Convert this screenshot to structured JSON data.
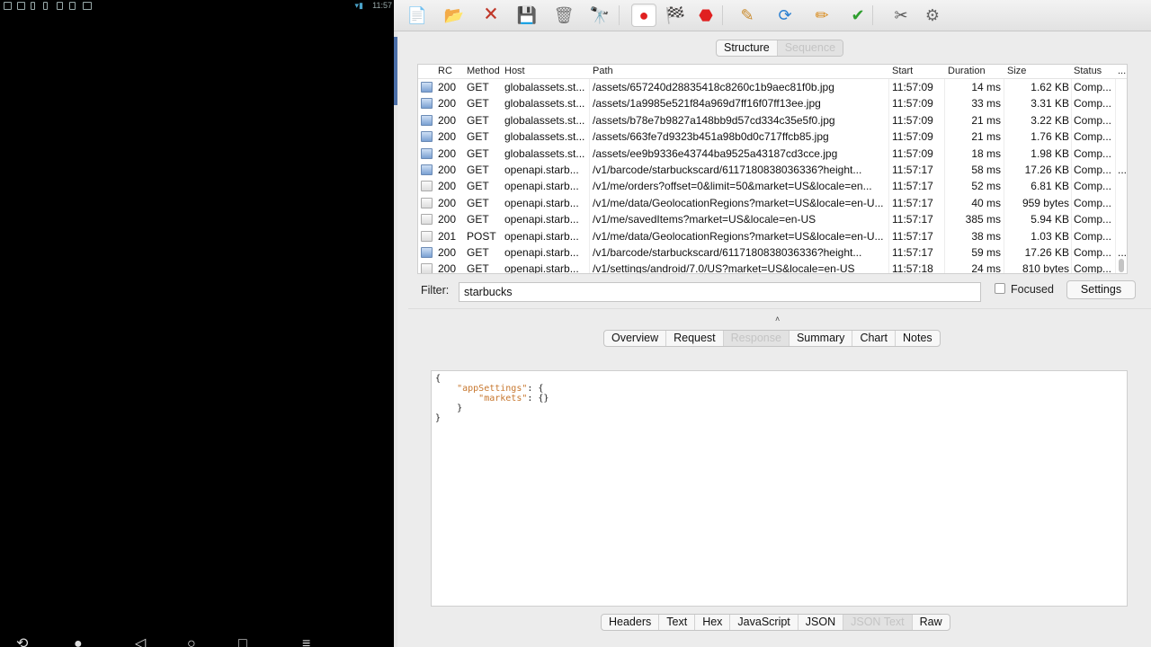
{
  "phone": {
    "status_time": "11:57"
  },
  "toolbar": {
    "buttons": [
      {
        "name": "new-session-icon",
        "glyph": "📄"
      },
      {
        "name": "open-session-icon",
        "glyph": "📂"
      },
      {
        "name": "close-session-icon",
        "glyph": "🗙"
      },
      {
        "name": "save-session-icon",
        "glyph": "💾"
      },
      {
        "name": "clear-session-icon",
        "glyph": "🗑"
      },
      {
        "name": "find-icon",
        "glyph": "🔭"
      },
      {
        "name": "record-icon",
        "glyph": "●"
      },
      {
        "name": "throttle-icon",
        "glyph": "🏁"
      },
      {
        "name": "breakpoints-icon",
        "glyph": "⬣"
      },
      {
        "name": "edit-icon",
        "glyph": "✎"
      },
      {
        "name": "repeat-icon",
        "glyph": "⟳"
      },
      {
        "name": "validate-icon",
        "glyph": "✏"
      },
      {
        "name": "check-icon",
        "glyph": "✔"
      },
      {
        "name": "tools-icon",
        "glyph": "✂"
      },
      {
        "name": "settings-gear-icon",
        "glyph": "⚙"
      }
    ]
  },
  "view_tabs": [
    "Structure",
    "Sequence"
  ],
  "table": {
    "headers": {
      "rc": "RC",
      "method": "Method",
      "host": "Host",
      "path": "Path",
      "start": "Start",
      "duration": "Duration",
      "size": "Size",
      "status": "Status",
      "more": "..."
    },
    "rows": [
      {
        "icon": "image",
        "rc": "200",
        "method": "GET",
        "host": "globalassets.st...",
        "path": "/assets/657240d28835418c8260c1b9aec81f0b.jpg",
        "start": "11:57:09",
        "duration": "14 ms",
        "size": "1.62 KB",
        "status": "Comp...",
        "more": ""
      },
      {
        "icon": "image",
        "rc": "200",
        "method": "GET",
        "host": "globalassets.st...",
        "path": "/assets/1a9985e521f84a969d7ff16f07ff13ee.jpg",
        "start": "11:57:09",
        "duration": "33 ms",
        "size": "3.31 KB",
        "status": "Comp...",
        "more": ""
      },
      {
        "icon": "image",
        "rc": "200",
        "method": "GET",
        "host": "globalassets.st...",
        "path": "/assets/b78e7b9827a148bb9d57cd334c35e5f0.jpg",
        "start": "11:57:09",
        "duration": "21 ms",
        "size": "3.22 KB",
        "status": "Comp...",
        "more": ""
      },
      {
        "icon": "image",
        "rc": "200",
        "method": "GET",
        "host": "globalassets.st...",
        "path": "/assets/663fe7d9323b451a98b0d0c717ffcb85.jpg",
        "start": "11:57:09",
        "duration": "21 ms",
        "size": "1.76 KB",
        "status": "Comp...",
        "more": ""
      },
      {
        "icon": "image",
        "rc": "200",
        "method": "GET",
        "host": "globalassets.st...",
        "path": "/assets/ee9b9336e43744ba9525a43187cd3cce.jpg",
        "start": "11:57:09",
        "duration": "18 ms",
        "size": "1.98 KB",
        "status": "Comp...",
        "more": ""
      },
      {
        "icon": "image",
        "rc": "200",
        "method": "GET",
        "host": "openapi.starb...",
        "path": "/v1/barcode/starbuckscard/6117180838036336?height...",
        "start": "11:57:17",
        "duration": "58 ms",
        "size": "17.26 KB",
        "status": "Comp...",
        "more": "..."
      },
      {
        "icon": "doc",
        "rc": "200",
        "method": "GET",
        "host": "openapi.starb...",
        "path": "/v1/me/orders?offset=0&limit=50&market=US&locale=en...",
        "start": "11:57:17",
        "duration": "52 ms",
        "size": "6.81 KB",
        "status": "Comp...",
        "more": ""
      },
      {
        "icon": "doc",
        "rc": "200",
        "method": "GET",
        "host": "openapi.starb...",
        "path": "/v1/me/data/GeolocationRegions?market=US&locale=en-U...",
        "start": "11:57:17",
        "duration": "40 ms",
        "size": "959 bytes",
        "status": "Comp...",
        "more": ""
      },
      {
        "icon": "doc",
        "rc": "200",
        "method": "GET",
        "host": "openapi.starb...",
        "path": "/v1/me/savedItems?market=US&locale=en-US",
        "start": "11:57:17",
        "duration": "385 ms",
        "size": "5.94 KB",
        "status": "Comp...",
        "more": ""
      },
      {
        "icon": "doc",
        "rc": "201",
        "method": "POST",
        "host": "openapi.starb...",
        "path": "/v1/me/data/GeolocationRegions?market=US&locale=en-U...",
        "start": "11:57:17",
        "duration": "38 ms",
        "size": "1.03 KB",
        "status": "Comp...",
        "more": ""
      },
      {
        "icon": "image",
        "rc": "200",
        "method": "GET",
        "host": "openapi.starb...",
        "path": "/v1/barcode/starbuckscard/6117180838036336?height...",
        "start": "11:57:17",
        "duration": "59 ms",
        "size": "17.26 KB",
        "status": "Comp...",
        "more": "..."
      },
      {
        "icon": "doc",
        "rc": "200",
        "method": "GET",
        "host": "openapi.starb...",
        "path": "/v1/settings/android/7.0/US?market=US&locale=en-US",
        "start": "11:57:18",
        "duration": "24 ms",
        "size": "810 bytes",
        "status": "Comp...",
        "more": ""
      }
    ]
  },
  "filter": {
    "label": "Filter:",
    "value": "starbucks",
    "focused_label": "Focused",
    "settings_label": "Settings"
  },
  "split_handle": "˄",
  "detail_tabs": [
    "Overview",
    "Request",
    "Response",
    "Summary",
    "Chart",
    "Notes"
  ],
  "detail_selected": "Response",
  "response_json": {
    "l1": "{",
    "l2_key": "\"appSettings\"",
    "l2_rest": ": {",
    "l3_key": "\"markets\"",
    "l3_rest": ": {}",
    "l4": "}",
    "l5": "}"
  },
  "format_tabs": [
    "Headers",
    "Text",
    "Hex",
    "JavaScript",
    "JSON",
    "JSON Text",
    "Raw"
  ],
  "format_selected": "JSON Text",
  "colors": {
    "json_key": "#c7772e",
    "record_red": "#e02020",
    "selected_tab_text": "#c4c4c4"
  }
}
